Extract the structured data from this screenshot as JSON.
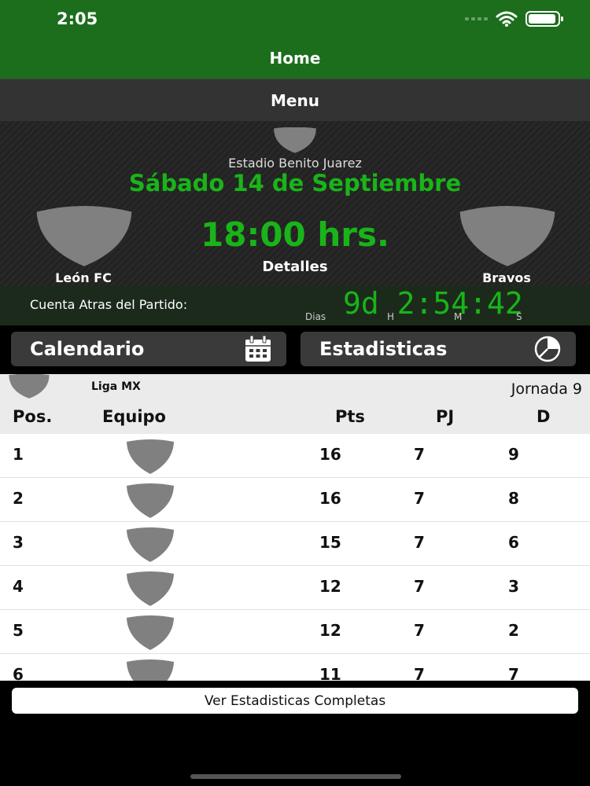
{
  "status": {
    "time": "2:05"
  },
  "navbar": {
    "title": "Home"
  },
  "menu": {
    "label": "Menu"
  },
  "match": {
    "stadium": "Estadio Benito Juarez",
    "date": "Sábado 14 de Septiembre",
    "time": "18:00 hrs.",
    "details": "Detalles",
    "home_team": "León FC",
    "away_team": "Bravos"
  },
  "countdown": {
    "label": "Cuenta Atras del Partido:",
    "value": "9d 2:54:42",
    "units": {
      "days": "Dias",
      "hours": "H",
      "minutes": "M",
      "seconds": "S"
    }
  },
  "buttons": {
    "calendar": "Calendario",
    "stats": "Estadisticas"
  },
  "standings": {
    "league": "Liga MX",
    "round": "Jornada 9",
    "columns": {
      "pos": "Pos.",
      "team": "Equipo",
      "pts": "Pts",
      "pj": "PJ",
      "d": "D"
    },
    "rows": [
      {
        "pos": "1",
        "pts": "16",
        "pj": "7",
        "d": "9"
      },
      {
        "pos": "2",
        "pts": "16",
        "pj": "7",
        "d": "8"
      },
      {
        "pos": "3",
        "pts": "15",
        "pj": "7",
        "d": "6"
      },
      {
        "pos": "4",
        "pts": "12",
        "pj": "7",
        "d": "3"
      },
      {
        "pos": "5",
        "pts": "12",
        "pj": "7",
        "d": "2"
      },
      {
        "pos": "6",
        "pts": "11",
        "pj": "7",
        "d": "7"
      }
    ]
  },
  "footer": {
    "complete_stats": "Ver Estadisticas Completas"
  },
  "colors": {
    "brand_green": "#1c6e1c",
    "accent_green": "#19b419",
    "shield_gray": "#808080"
  }
}
